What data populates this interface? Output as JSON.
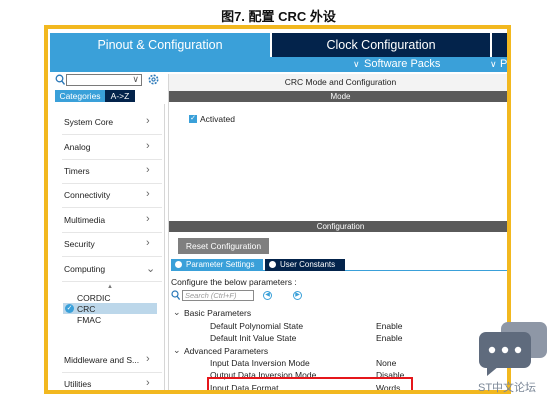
{
  "figure": {
    "caption": "图7. 配置 CRC 外设"
  },
  "tabs": {
    "pinout": "Pinout & Configuration",
    "clock": "Clock Configuration"
  },
  "subbar": {
    "software_packs": "Software Packs",
    "truncated": "P"
  },
  "left": {
    "categories_btn": "Categories",
    "az_btn": "A->Z",
    "items": [
      {
        "label": "System Core",
        "arrow": "›"
      },
      {
        "label": "Analog",
        "arrow": "›"
      },
      {
        "label": "Timers",
        "arrow": "›"
      },
      {
        "label": "Connectivity",
        "arrow": "›"
      },
      {
        "label": "Multimedia",
        "arrow": "›"
      },
      {
        "label": "Security",
        "arrow": "›"
      },
      {
        "label": "Computing",
        "arrow": "⌄"
      },
      {
        "label": "Middleware and S...",
        "arrow": "›"
      },
      {
        "label": "Utilities",
        "arrow": "›"
      }
    ],
    "computing_children": [
      "CORDIC",
      "CRC",
      "FMAC"
    ]
  },
  "right": {
    "panel_title": "CRC Mode and Configuration",
    "mode_header": "Mode",
    "activated_label": "Activated",
    "config_header": "Configuration",
    "reset_btn": "Reset Configuration",
    "param_tab": "Parameter Settings",
    "user_tab": "User Constants",
    "configure_text": "Configure the below parameters :",
    "search_placeholder": "Search (Ctrl+F)",
    "groups": [
      {
        "name": "Basic Parameters",
        "params": [
          {
            "name": "Default Polynomial State",
            "value": "Enable"
          },
          {
            "name": "Default Init Value State",
            "value": "Enable"
          }
        ]
      },
      {
        "name": "Advanced Parameters",
        "params": [
          {
            "name": "Input Data Inversion Mode",
            "value": "None"
          },
          {
            "name": "Output Data Inversion Mode",
            "value": "Disable"
          },
          {
            "name": "Input Data Format",
            "value": "Words"
          }
        ]
      }
    ]
  },
  "watermark": "ST中文论坛",
  "colors": {
    "accent": "#3aa0d9",
    "dark": "#03234b",
    "frame": "#f2b81f",
    "highlight": "#e5161b"
  }
}
